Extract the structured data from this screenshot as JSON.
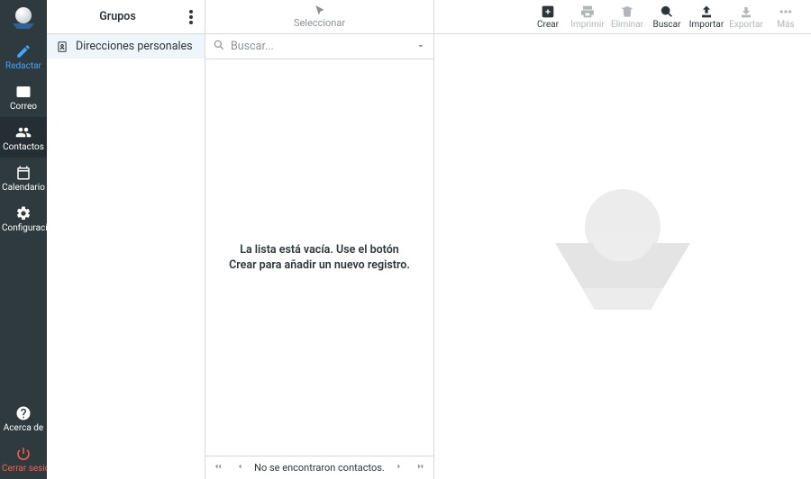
{
  "sidebar": {
    "compose": "Redactar",
    "mail": "Correo",
    "contacts": "Contactos",
    "calendar": "Calendario",
    "settings": "Configuraci...",
    "about": "Acerca de",
    "logout": "Cerrar sesión"
  },
  "groups": {
    "title": "Grupos",
    "items": [
      {
        "label": "Direcciones personales"
      }
    ]
  },
  "select_toolbar": {
    "label": "Seleccionar"
  },
  "search": {
    "placeholder": "Buscar..."
  },
  "contacts_list": {
    "empty_message": "La lista está vacía. Use el botón Crear para añadir un nuevo registro."
  },
  "pager": {
    "status": "No se encontraron contactos."
  },
  "toolbar": {
    "create": "Crear",
    "print": "Imprimir",
    "delete": "Eliminar",
    "search": "Buscar",
    "import": "Importar",
    "export": "Exportar",
    "more": "Más"
  }
}
